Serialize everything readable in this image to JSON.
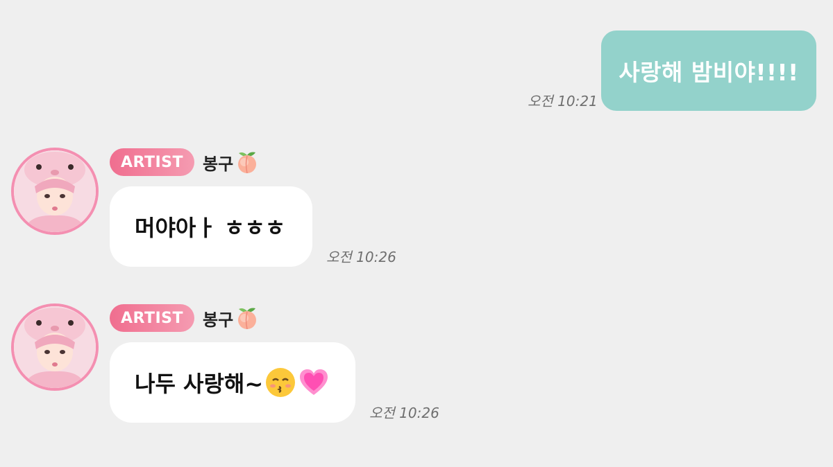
{
  "messages": [
    {
      "direction": "outgoing",
      "text": "사랑해 밤비야!!!!",
      "time": "오전 10:21",
      "bubble_color": "#93d2cb"
    },
    {
      "direction": "incoming",
      "badge": "ARTIST",
      "sender": "봉구",
      "sender_emoji": "peach-icon",
      "text": "머야아ㅏ ㅎㅎㅎ",
      "time": "오전 10:26"
    },
    {
      "direction": "incoming",
      "badge": "ARTIST",
      "sender": "봉구",
      "sender_emoji": "peach-icon",
      "text": "나두 사랑해~",
      "text_emojis": [
        "kissing-face-icon",
        "pink-heart-icon"
      ],
      "time": "오전 10:26"
    }
  ],
  "colors": {
    "background": "#efefef",
    "outgoing_bubble": "#93d2cb",
    "incoming_bubble": "#ffffff",
    "badge_start": "#f06e8f",
    "badge_end": "#f59bb1",
    "avatar_ring": "#f48fb1"
  }
}
